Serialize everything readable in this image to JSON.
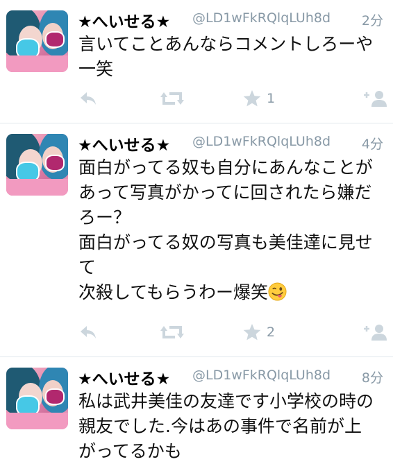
{
  "tweets": [
    {
      "name": "★へいせる★",
      "handle": "@LD1wFkRQlqLUh8d",
      "time": "2分",
      "lines": [
        "言いてことあんならコメントしろーや",
        "一笑"
      ],
      "favorites": "1"
    },
    {
      "name": "★へいせる★",
      "handle": "@LD1wFkRQlqLUh8d",
      "time": "4分",
      "lines": [
        "面白がってる奴も自分にあんなことが",
        "あって写真がかってに回されたら嫌だ",
        "ろー？",
        "面白がってる奴の写真も美佳達に見せ",
        "て",
        "次殺してもらうわー爆笑"
      ],
      "favorites": "2",
      "emoji": "winking-tongue-face"
    },
    {
      "name": "★へいせる★",
      "handle": "@LD1wFkRQlqLUh8d",
      "time": "8分",
      "lines": [
        "私は武井美佳の友達です小学校の時の",
        "親友でした.今はあの事件で名前が上",
        "がってるかも"
      ]
    }
  ],
  "icons": {
    "reply": "reply-arrow-icon",
    "retweet": "retweet-icon",
    "favorite": "star-icon",
    "follow": "add-user-icon"
  },
  "colors": {
    "icon": "#ccd6dd",
    "meta": "#8899a6",
    "divider": "#e1e8ed",
    "name": "#000000"
  }
}
